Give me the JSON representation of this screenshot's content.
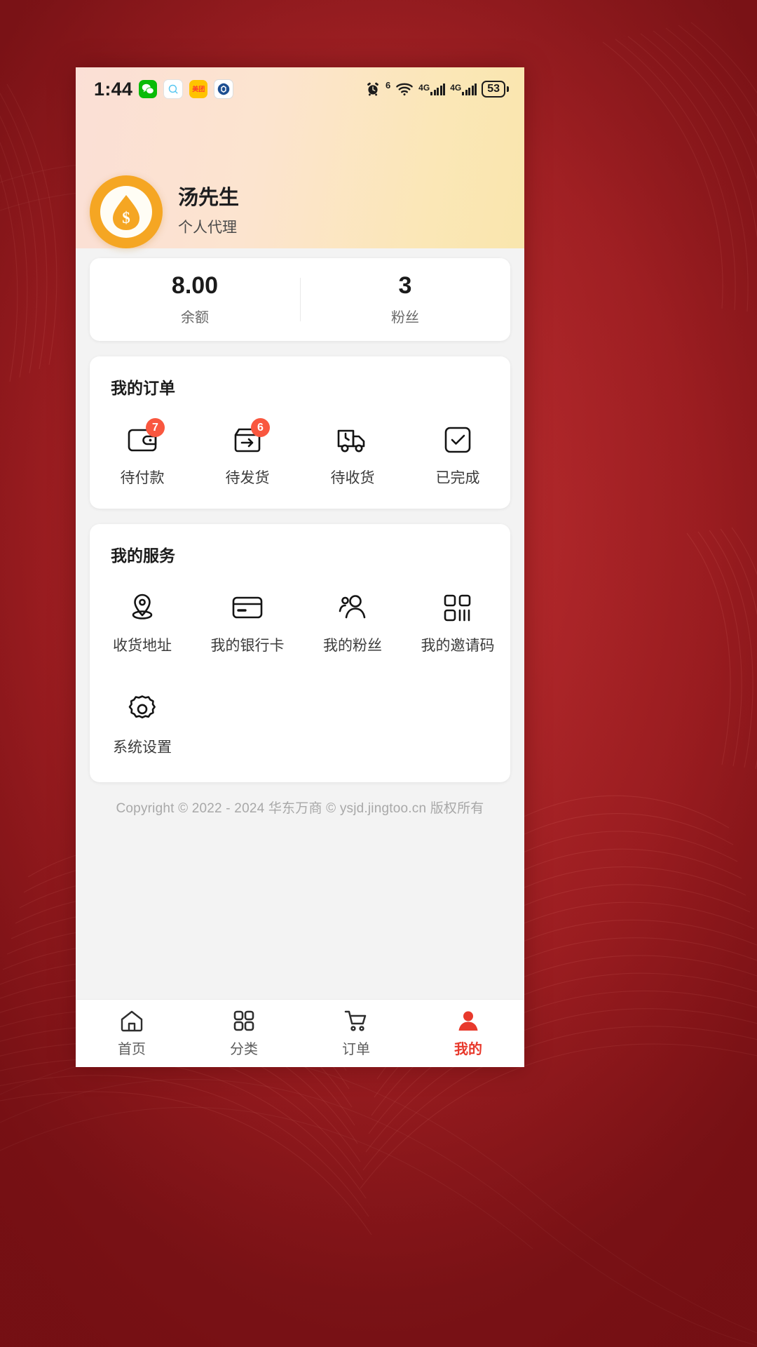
{
  "statusbar": {
    "time": "1:44",
    "app_icons": [
      "wechat-icon",
      "qq-icon",
      "meituan-icon",
      "ccb-bank-icon"
    ],
    "wechat_label": "",
    "meituan_label": "美团",
    "alarm_icon": "alarm-icon",
    "wifi_icon": "wifi-icon",
    "wifi_generation": "6",
    "network_1": "4G",
    "network_2": "4G",
    "battery_level": "53"
  },
  "profile": {
    "avatar_icon": "coin-drop-avatar",
    "name": "汤先生",
    "role": "个人代理"
  },
  "stats": [
    {
      "value": "8.00",
      "label": "余额"
    },
    {
      "value": "3",
      "label": "粉丝"
    }
  ],
  "orders": {
    "title": "我的订单",
    "items": [
      {
        "label": "待付款",
        "icon": "wallet-icon",
        "badge": "7"
      },
      {
        "label": "待发货",
        "icon": "box-arrow-icon",
        "badge": "6"
      },
      {
        "label": "待收货",
        "icon": "truck-icon",
        "badge": ""
      },
      {
        "label": "已完成",
        "icon": "check-square-icon",
        "badge": ""
      }
    ]
  },
  "services": {
    "title": "我的服务",
    "items": [
      {
        "label": "收货地址",
        "icon": "location-pin-icon"
      },
      {
        "label": "我的银行卡",
        "icon": "credit-card-icon"
      },
      {
        "label": "我的粉丝",
        "icon": "people-icon"
      },
      {
        "label": "我的邀请码",
        "icon": "qr-code-icon"
      },
      {
        "label": "系统设置",
        "icon": "gear-icon"
      }
    ]
  },
  "footer": {
    "copyright": "Copyright © 2022 - 2024 华东万商 © ysjd.jingtoo.cn 版权所有"
  },
  "tabbar": {
    "items": [
      {
        "label": "首页",
        "icon": "home-icon",
        "active": false
      },
      {
        "label": "分类",
        "icon": "grid-icon",
        "active": false
      },
      {
        "label": "订单",
        "icon": "cart-icon",
        "active": false
      },
      {
        "label": "我的",
        "icon": "user-icon",
        "active": true
      }
    ],
    "active_color": "#e8392c"
  },
  "theme": {
    "background_red": "#b72b2e",
    "badge_red": "#f9573f",
    "avatar_gold": "#f5a623"
  }
}
